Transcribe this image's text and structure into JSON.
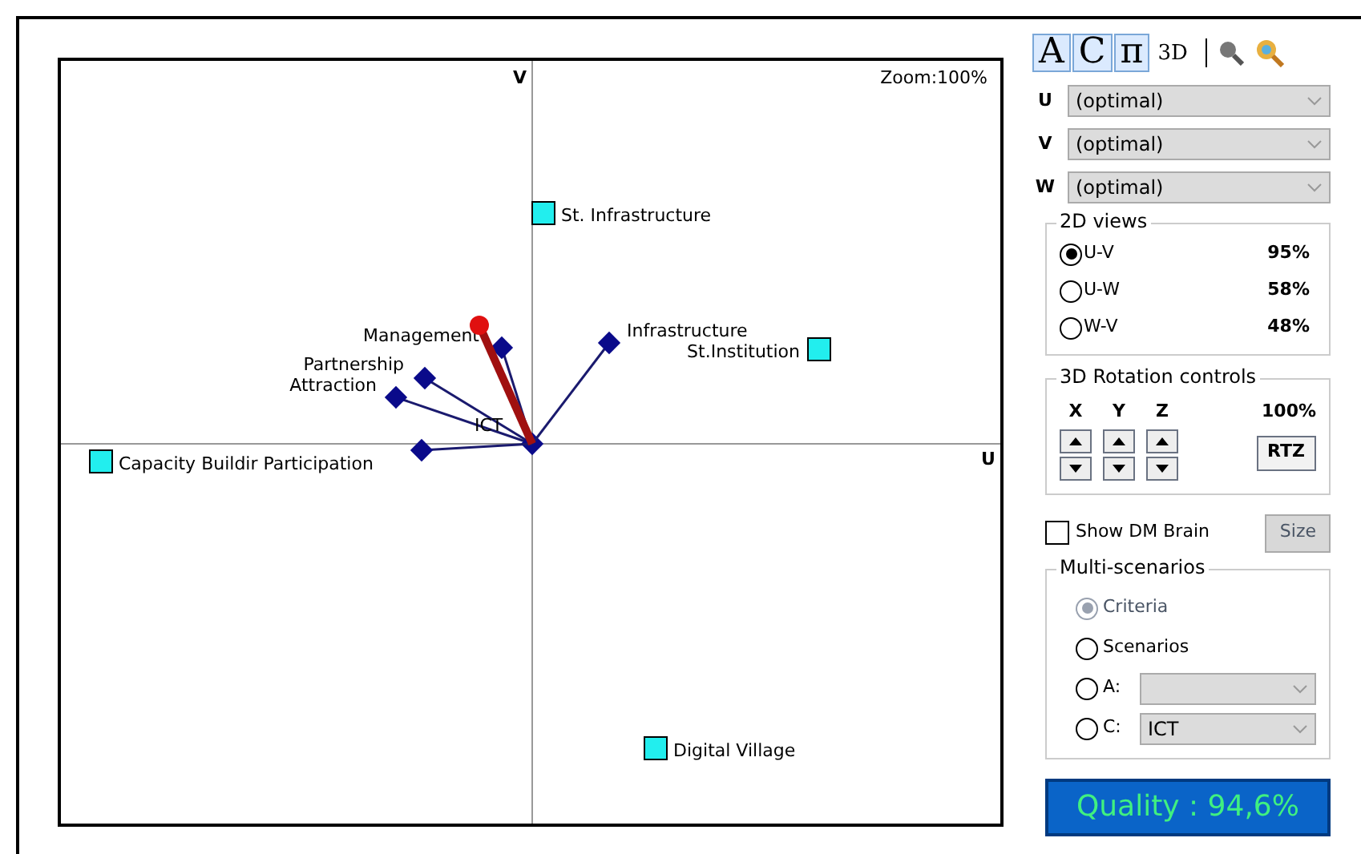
{
  "plot": {
    "v_axis": "V",
    "u_axis": "U",
    "zoom": "Zoom:100%",
    "criteria": [
      {
        "kind": "labeled",
        "label": "Management"
      },
      {
        "kind": "labeled",
        "label": "Partnership"
      },
      {
        "kind": "labeled",
        "label": "Attraction"
      },
      {
        "kind": "labeled",
        "label": "ICT"
      },
      {
        "kind": "labeled",
        "label": "Infrastructure"
      },
      {
        "kind": "unlabeled"
      }
    ],
    "actions": [
      {
        "label": "St. Infrastructure"
      },
      {
        "label": "St.Institution"
      },
      {
        "label": "Capacity Buildir Participation"
      },
      {
        "label": "Digital Village"
      }
    ]
  },
  "toolbar": [
    {
      "label": "A",
      "selected": true
    },
    {
      "label": "C",
      "selected": true
    },
    {
      "label": "π",
      "selected": true
    },
    {
      "label": "3D",
      "selected": false
    }
  ],
  "axes": [
    {
      "name": "U",
      "value": "(optimal)"
    },
    {
      "name": "V",
      "value": "(optimal)"
    },
    {
      "name": "W",
      "value": "(optimal)"
    }
  ],
  "views_2d": {
    "title": "2D views",
    "items": [
      {
        "label": "U-V",
        "value": "95%",
        "selected": true
      },
      {
        "label": "U-W",
        "value": "58%",
        "selected": false
      },
      {
        "label": "W-V",
        "value": "48%",
        "selected": false
      }
    ]
  },
  "rotation": {
    "title": "3D Rotation controls",
    "axes": [
      "X",
      "Y",
      "Z"
    ],
    "percent": "100%",
    "reset": "RTZ"
  },
  "dm_brain": {
    "label": "Show DM Brain",
    "checked": false,
    "size_button": "Size"
  },
  "multi": {
    "title": "Multi-scenarios",
    "options": [
      {
        "label": "Criteria",
        "selected": true,
        "disabled": true
      },
      {
        "label": "Scenarios",
        "selected": false,
        "disabled": false
      },
      {
        "label": "A:",
        "selected": false,
        "disabled": false,
        "kind": "dropdown"
      },
      {
        "label": "C:",
        "selected": false,
        "disabled": false,
        "kind": "dropdown",
        "value": "ICT"
      }
    ]
  },
  "quality": "Quality : 94,6%"
}
